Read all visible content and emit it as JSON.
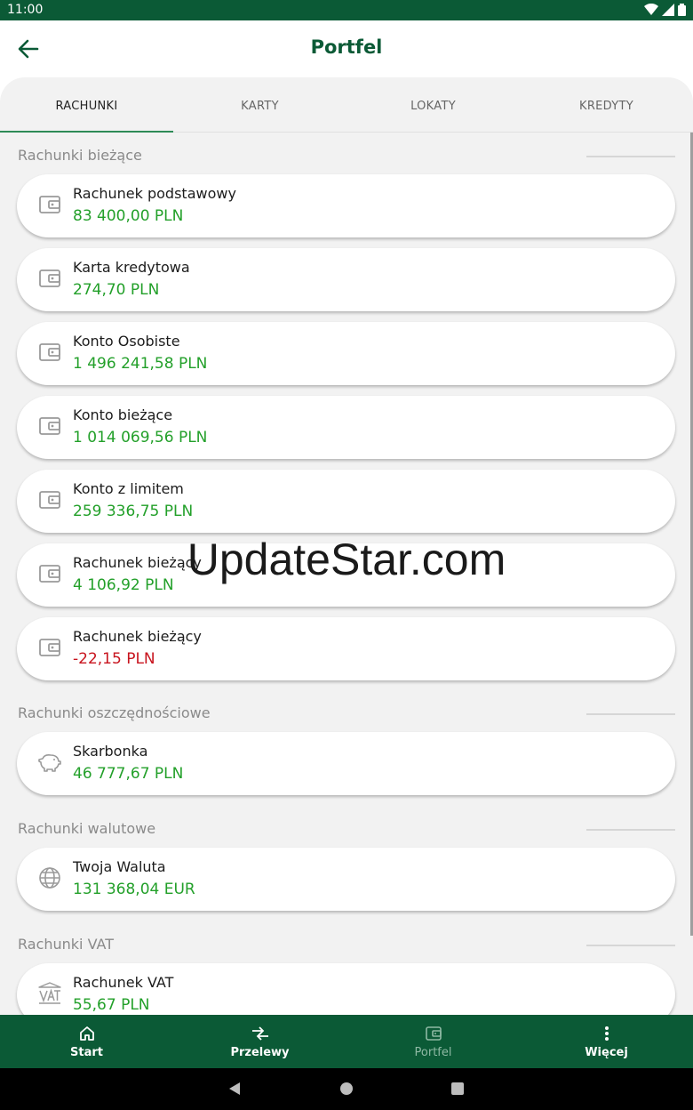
{
  "status_bar": {
    "time": "11:00"
  },
  "header": {
    "title": "Portfel"
  },
  "tabs": [
    {
      "label": "RACHUNKI",
      "active": true
    },
    {
      "label": "KARTY",
      "active": false
    },
    {
      "label": "LOKATY",
      "active": false
    },
    {
      "label": "KREDYTY",
      "active": false
    }
  ],
  "sections": [
    {
      "title": "Rachunki bieżące",
      "accounts": [
        {
          "name": "Rachunek podstawowy",
          "amount": "83 400,00 PLN",
          "icon": "wallet-icon"
        },
        {
          "name": "Karta kredytowa",
          "amount": "274,70 PLN",
          "icon": "wallet-icon"
        },
        {
          "name": "Konto Osobiste",
          "amount": "1 496 241,58 PLN",
          "icon": "wallet-icon"
        },
        {
          "name": "Konto bieżące",
          "amount": "1 014 069,56 PLN",
          "icon": "wallet-icon"
        },
        {
          "name": "Konto z limitem",
          "amount": "259 336,75 PLN",
          "icon": "wallet-icon"
        },
        {
          "name": "Rachunek bieżący",
          "amount": "4 106,92 PLN",
          "icon": "wallet-icon"
        },
        {
          "name": "Rachunek bieżący",
          "amount": "-22,15 PLN",
          "icon": "wallet-icon",
          "negative": true
        }
      ]
    },
    {
      "title": "Rachunki oszczędnościowe",
      "accounts": [
        {
          "name": "Skarbonka",
          "amount": "46 777,67 PLN",
          "icon": "piggy-bank-icon"
        }
      ]
    },
    {
      "title": "Rachunki walutowe",
      "accounts": [
        {
          "name": "Twoja Waluta",
          "amount": "131 368,04 EUR",
          "icon": "globe-icon"
        }
      ]
    },
    {
      "title": "Rachunki VAT",
      "accounts": [
        {
          "name": "Rachunek VAT",
          "amount": "55,67 PLN",
          "icon": "vat-icon"
        }
      ]
    }
  ],
  "watermark": "UpdateStar.com",
  "bottom_nav": [
    {
      "label": "Start",
      "icon": "home-icon",
      "active": false
    },
    {
      "label": "Przelewy",
      "icon": "transfer-icon",
      "active": false
    },
    {
      "label": "Portfel",
      "icon": "wallet-icon",
      "active": true
    },
    {
      "label": "Więcej",
      "icon": "more-vertical-icon",
      "active": false
    }
  ],
  "colors": {
    "brand": "#0b5a36",
    "positive_amount": "#23a02a",
    "negative_amount": "#c8141e",
    "active_tab_indicator": "#2e8b57"
  }
}
